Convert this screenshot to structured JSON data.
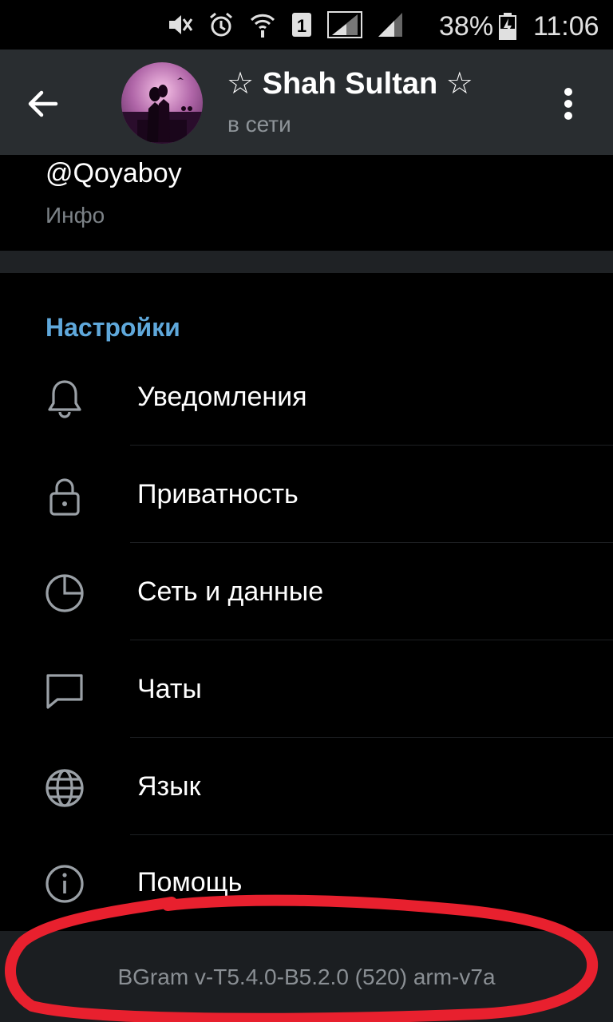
{
  "status_bar": {
    "battery_percent": "38%",
    "time": "11:06",
    "icons": [
      "mute-icon",
      "alarm-icon",
      "wifi-icon",
      "sim1-icon",
      "signal-icon",
      "signal-icon",
      "battery-charging-icon"
    ]
  },
  "header": {
    "title": "☆ Shah Sultan ☆",
    "subtitle": "в сети"
  },
  "profile": {
    "username": "@Qoyaboy",
    "username_label": "Инфо"
  },
  "settings": {
    "header": "Настройки",
    "items": [
      {
        "label": "Уведомления",
        "icon": "bell-icon"
      },
      {
        "label": "Приватность",
        "icon": "lock-icon"
      },
      {
        "label": "Сеть и данные",
        "icon": "data-usage-icon"
      },
      {
        "label": "Чаты",
        "icon": "chat-icon"
      },
      {
        "label": "Язык",
        "icon": "globe-icon"
      },
      {
        "label": "Помощь",
        "icon": "info-icon"
      }
    ]
  },
  "footer": {
    "version": "BGram v-T5.4.0-B5.2.0 (520) arm-v7a"
  },
  "colors": {
    "accent": "#5fa8db",
    "appbar": "#292d30",
    "annotation": "#e8202e"
  }
}
